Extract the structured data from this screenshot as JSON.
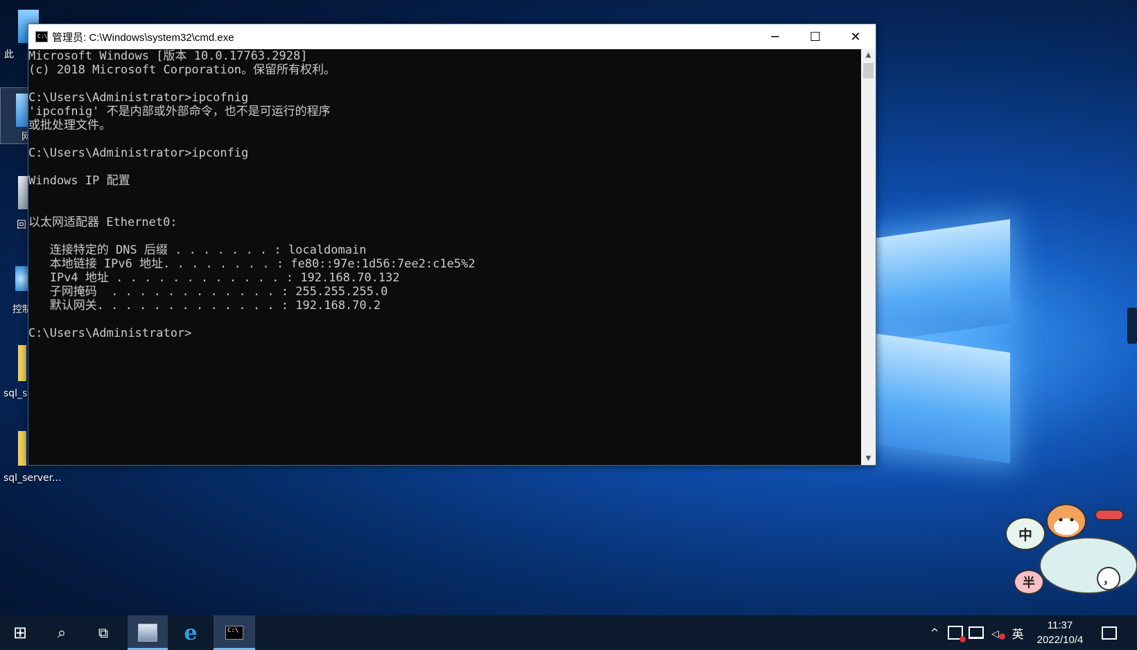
{
  "desktop": {
    "icons": [
      {
        "label": "此",
        "icon": "this-pc-icon"
      },
      {
        "label": "网",
        "icon": "network-icon"
      },
      {
        "label": "回",
        "icon": "recycle-bin-icon"
      },
      {
        "label": "控制",
        "icon": "control-panel-icon"
      },
      {
        "label": "sql_s",
        "icon": "folder-icon"
      },
      {
        "label": "sql_server...",
        "icon": "folder-icon"
      }
    ]
  },
  "window": {
    "title": "管理员: C:\\Windows\\system32\\cmd.exe",
    "minimize": "─",
    "maximize": "☐",
    "close": "✕",
    "lines": [
      "Microsoft Windows [版本 10.0.17763.2928]",
      "(c) 2018 Microsoft Corporation。保留所有权利。",
      "",
      "C:\\Users\\Administrator>ipcofnig",
      "'ipcofnig' 不是内部或外部命令，也不是可运行的程序",
      "或批处理文件。",
      "",
      "C:\\Users\\Administrator>ipconfig",
      "",
      "Windows IP 配置",
      "",
      "",
      "以太网适配器 Ethernet0:",
      "",
      "   连接特定的 DNS 后缀 . . . . . . . : localdomain",
      "   本地链接 IPv6 地址. . . . . . . . : fe80::97e:1d56:7ee2:c1e5%2",
      "   IPv4 地址 . . . . . . . . . . . . : 192.168.70.132",
      "   子网掩码  . . . . . . . . . . . . : 255.255.255.0",
      "   默认网关. . . . . . . . . . . . . : 192.168.70.2",
      "",
      "C:\\Users\\Administrator>"
    ]
  },
  "ime_mascot": {
    "ime_char": "中",
    "mode_char": "半",
    "punct_char": "，"
  },
  "taskbar": {
    "start": "⊞",
    "search": "⌕",
    "taskview": "⧉",
    "tray": {
      "chevron": "^",
      "ime": "英"
    },
    "clock": {
      "time": "11:37",
      "date": "2022/10/4"
    }
  }
}
